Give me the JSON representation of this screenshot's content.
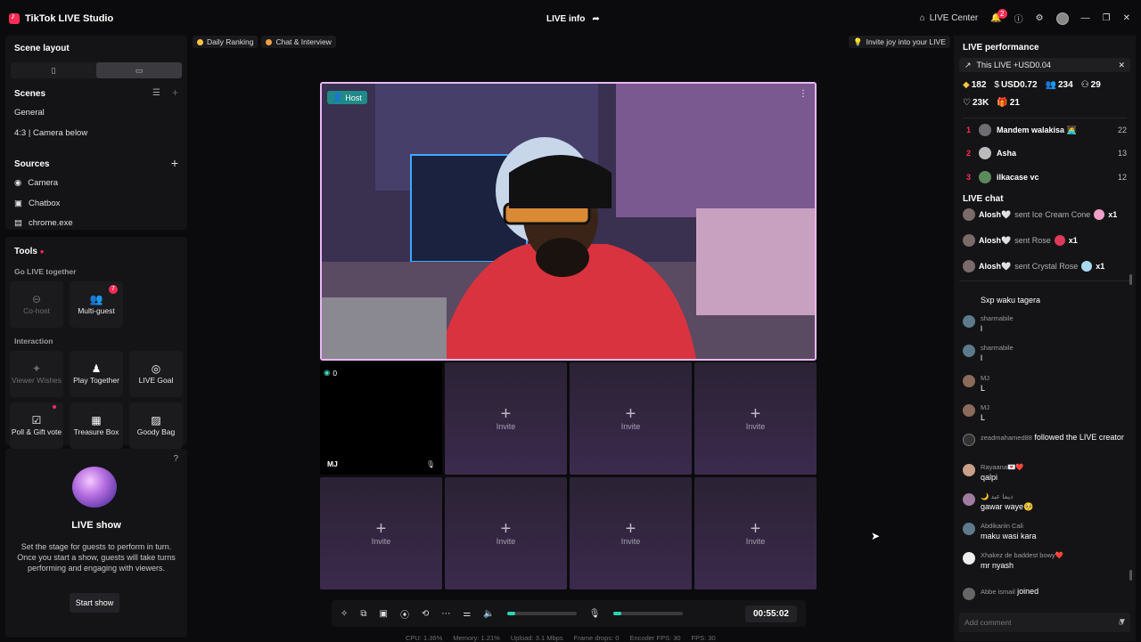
{
  "app": {
    "title": "TikTok LIVE Studio",
    "center_title": "LIVE info",
    "live_center": "LIVE Center",
    "notif_count": "2"
  },
  "scene_layout": {
    "title": "Scene layout",
    "selected": "landscape"
  },
  "scenes": {
    "title": "Scenes",
    "items": [
      "General",
      "4:3 | Camera below"
    ]
  },
  "sources": {
    "title": "Sources",
    "items": [
      {
        "label": "Camera",
        "icon": "camera-icon"
      },
      {
        "label": "Chatbox",
        "icon": "chat-icon"
      },
      {
        "label": "chrome.exe",
        "icon": "window-icon"
      }
    ]
  },
  "tools": {
    "title": "Tools",
    "go_live_together": "Go LIVE together",
    "cohost": "Co-host",
    "multiguest": "Multi-guest",
    "multiguest_badge": "7",
    "interaction": "Interaction",
    "viewer_wishes": "Viewer Wishes",
    "play_together": "Play Together",
    "live_goal": "LIVE Goal",
    "poll_gift_vote": "Poll & Gift vote",
    "treasure_box": "Treasure Box",
    "goody_bag": "Goody Bag"
  },
  "live_show": {
    "title": "LIVE show",
    "description": "Set the stage for guests to perform in turn. Once you start a show, guests will take turns performing and engaging with viewers.",
    "button": "Start show"
  },
  "center": {
    "tab_daily_ranking": "Daily Ranking",
    "tab_chat_interview": "Chat & Interview",
    "invite_joy": "Invite joy into your LIVE",
    "host_tag": "Host",
    "mj_count": "0",
    "mj_name": "MJ",
    "invite_label": "Invite",
    "timer": "00:55:02",
    "volume_level": 0.12,
    "mic_level": 0.12
  },
  "stats": {
    "cpu": "CPU: 1.36%",
    "memory": "Memory: 1.21%",
    "upload": "Upload: 3.1 Mbps",
    "frame_drops": "Frame drops: 0",
    "encoder_fps": "Encoder FPS: 30",
    "fps": "FPS: 30"
  },
  "performance": {
    "title": "LIVE performance",
    "this_live": "This LIVE +USD0.04",
    "diamonds": "182",
    "usd": "USD0.72",
    "viewers": "234",
    "followers": "29",
    "likes": "23K",
    "gifters": "21",
    "ranking": [
      {
        "rank": "1",
        "name": "Mandem walakisa 🧑‍💻",
        "score": "22"
      },
      {
        "rank": "2",
        "name": "Asha",
        "score": "13"
      },
      {
        "rank": "3",
        "name": "ilkacase vc",
        "score": "12"
      }
    ]
  },
  "chat": {
    "title": "LIVE chat",
    "gifts": [
      {
        "name": "Alosh🤍",
        "action": "sent Ice Cream Cone",
        "count": "x1",
        "color": "#f0a0c8"
      },
      {
        "name": "Alosh🤍",
        "action": "sent Rose",
        "count": "x1",
        "color": "#e03a5a"
      },
      {
        "name": "Alosh🤍",
        "action": "sent Crystal Rose",
        "count": "x1",
        "color": "#a8d8f0"
      }
    ],
    "messages": [
      {
        "user": "",
        "text": "Sxp waku tagera"
      },
      {
        "user": "sharmabile",
        "text": "l"
      },
      {
        "user": "sharmabile",
        "text": "l"
      },
      {
        "user": "MJ",
        "text": "L"
      },
      {
        "user": "MJ",
        "text": "L"
      },
      {
        "user": "zeadmahamed88",
        "inline": "followed the LIVE creator"
      },
      {
        "user": "Rayaana💌❤️",
        "text": "qalpi"
      },
      {
        "user": "🌙 ديما عبد",
        "text": "gawar waye🥺"
      },
      {
        "user": "Abdikariin Cali",
        "text": "maku wasi kara"
      },
      {
        "user": "Xhakez de baddest bowy❤️",
        "text": "mr nyash"
      },
      {
        "user": "Abbe ismail",
        "inline": "joined"
      }
    ],
    "add_comment_placeholder": "Add comment"
  }
}
